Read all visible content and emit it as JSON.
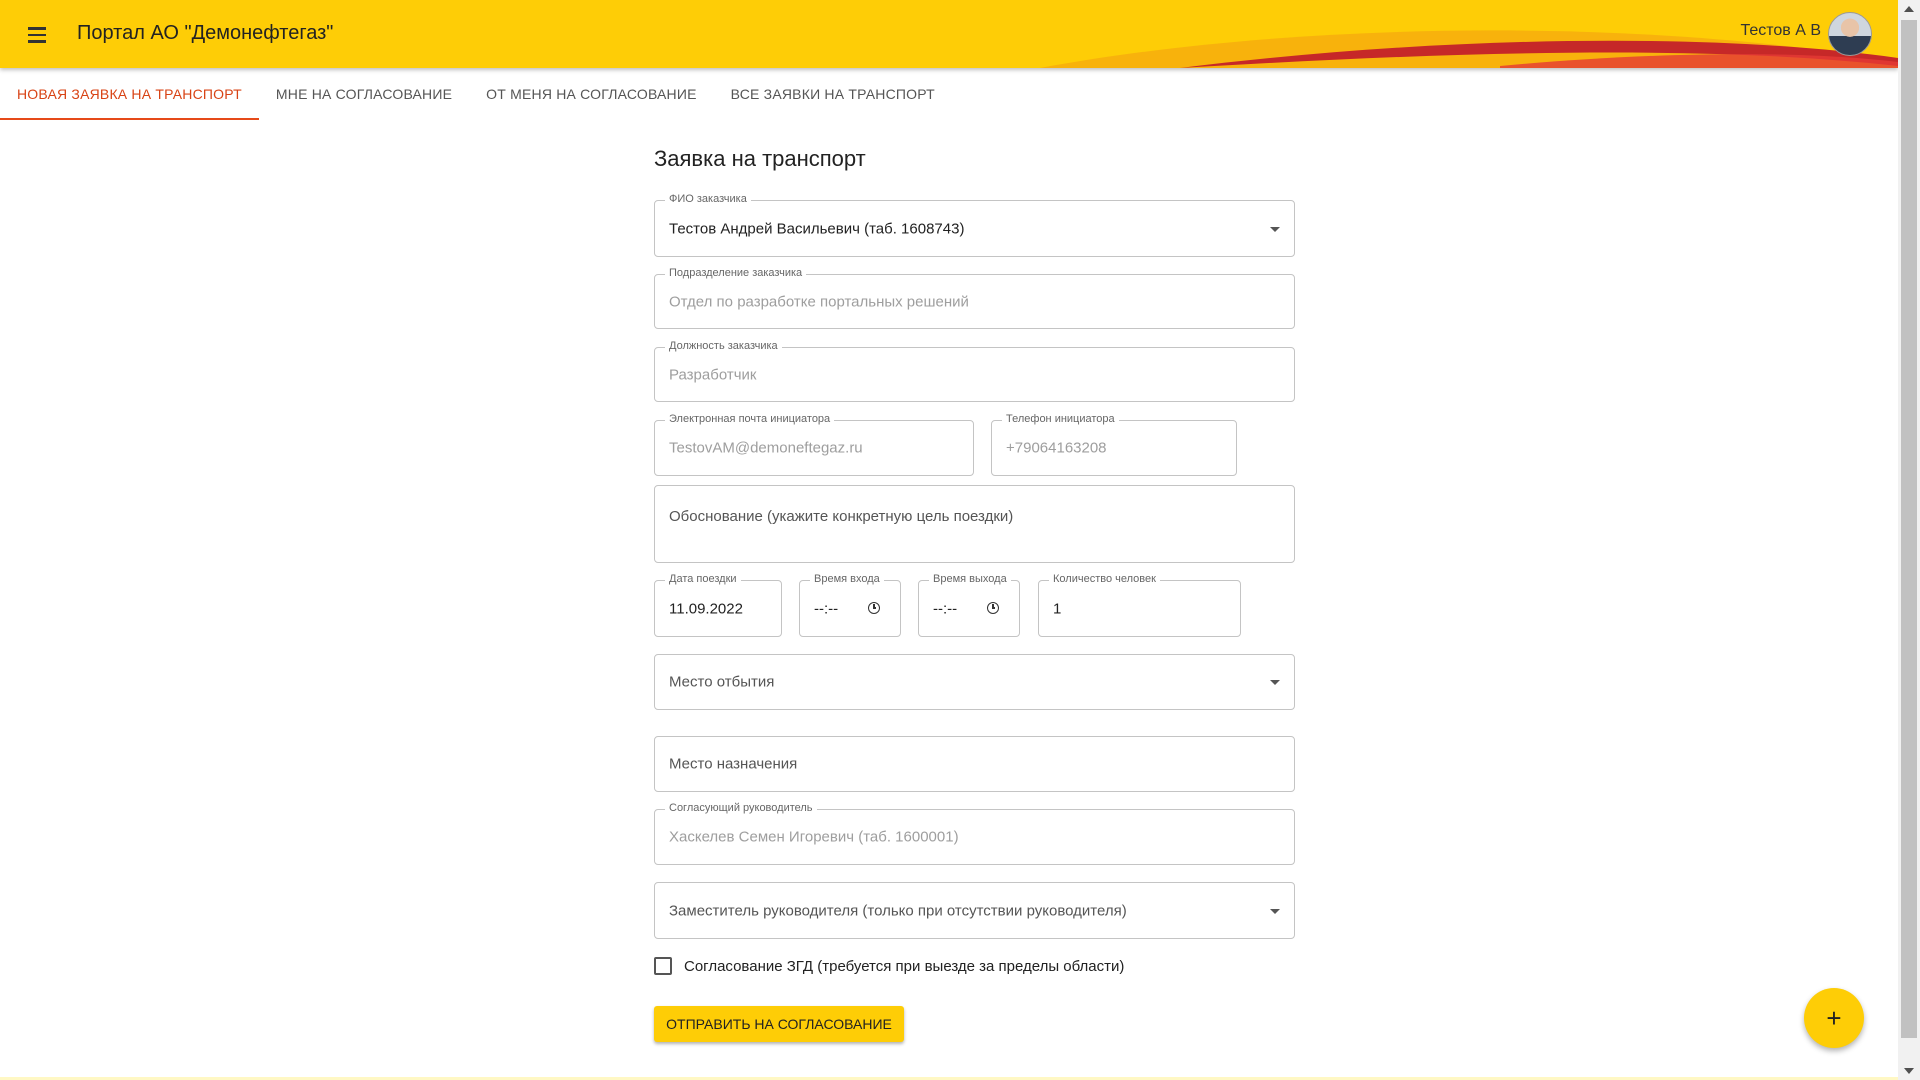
{
  "header": {
    "app_title": "Портал АО \"Демонефтегаз\"",
    "user_name": "Тестов А В",
    "brand_color": "#fecd06",
    "accent_color": "#d32f2f"
  },
  "tabs": [
    {
      "label": "НОВАЯ ЗАЯВКА НА ТРАНСПОРТ",
      "active": true
    },
    {
      "label": "МНЕ НА СОГЛАСОВАНИЕ",
      "active": false
    },
    {
      "label": "ОТ МЕНЯ НА СОГЛАСОВАНИЕ",
      "active": false
    },
    {
      "label": "ВСЕ ЗАЯВКИ НА ТРАНСПОРТ",
      "active": false
    }
  ],
  "form": {
    "title": "Заявка на транспорт",
    "customer_name": {
      "label": "ФИО заказчика",
      "value": "Тестов Андрей Васильевич (таб. 1608743)"
    },
    "department": {
      "label": "Подразделение заказчика",
      "value": "Отдел по разработке портальных решений"
    },
    "position": {
      "label": "Должность заказчика",
      "value": "Разработчик"
    },
    "email": {
      "label": "Электронная почта инициатора",
      "value": "TestovAM@demoneftegaz.ru"
    },
    "phone": {
      "label": "Телефон инициатора",
      "value": "+79064163208"
    },
    "justification": {
      "placeholder": "Обоснование (укажите конкретную цель поездки)"
    },
    "trip_date": {
      "label": "Дата поездки",
      "value": "11.09.2022"
    },
    "entry_time": {
      "label": "Время входа",
      "value": "--:--"
    },
    "exit_time": {
      "label": "Время выхода",
      "value": "--:--"
    },
    "people_count": {
      "label": "Количество человек",
      "value": "1"
    },
    "departure": {
      "placeholder": "Место отбытия"
    },
    "destination": {
      "placeholder": "Место назначения"
    },
    "approver": {
      "label": "Согласующий руководитель",
      "value": "Хаскелев Семен Игоревич (таб. 1600001)"
    },
    "deputy": {
      "placeholder": "Заместитель руководителя (только при отсутствии руководителя)"
    },
    "zgd_checkbox": {
      "label": "Согласование ЗГД (требуется при выезде за пределы области)",
      "checked": false
    },
    "submit_label": "ОТПРАВИТЬ НА СОГЛАСОВАНИЕ"
  },
  "fab": {
    "icon": "plus-icon",
    "label": "+"
  }
}
